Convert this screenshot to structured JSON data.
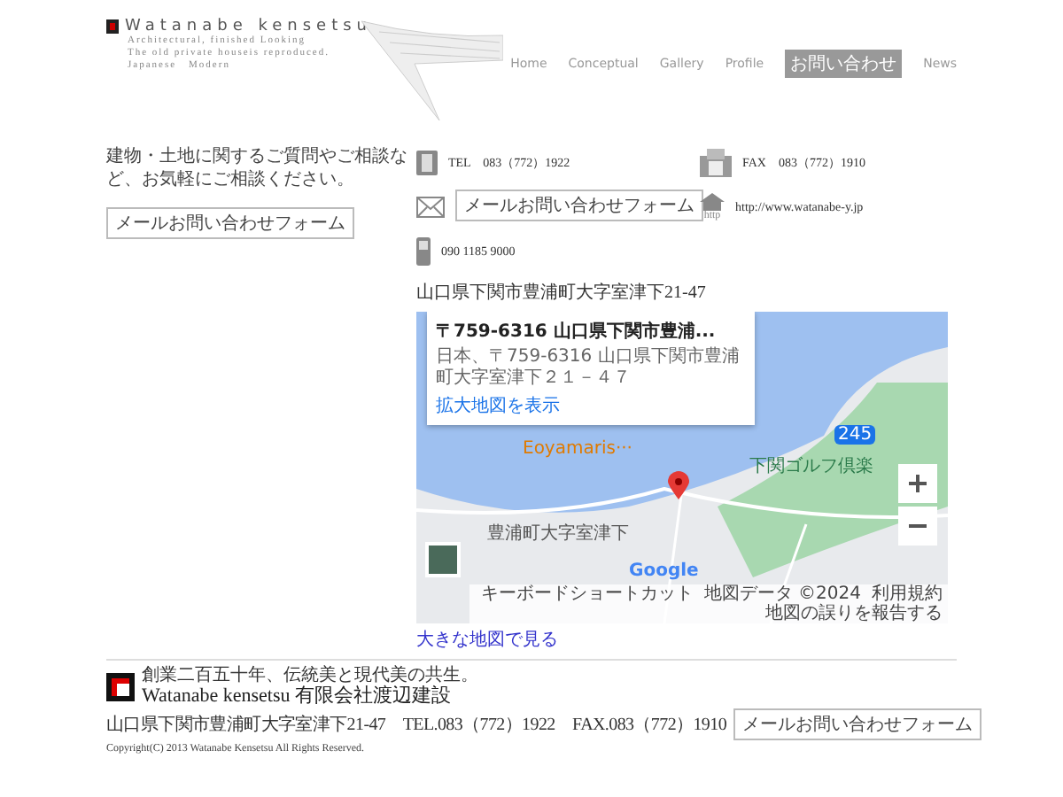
{
  "header": {
    "logo_text": "Watanabe kensetsu",
    "tagline": [
      "Architectural, finished Looking",
      "The old private houseis reproduced.",
      "Japanese　Modern"
    ]
  },
  "nav": [
    {
      "label": "Home",
      "selected": false
    },
    {
      "label": "Conceptual",
      "selected": false
    },
    {
      "label": "Gallery",
      "selected": false
    },
    {
      "label": "Profile",
      "selected": false
    },
    {
      "label": "お問い合わせ",
      "selected": true
    },
    {
      "label": "News",
      "selected": false
    }
  ],
  "intro": {
    "text": "建物・土地に関するご質問やご相談など、お気軽にご相談ください。",
    "button": "メールお問い合わせフォーム"
  },
  "contacts": {
    "tel": "TEL　083（772）1922",
    "mail_button": "メールお問い合わせフォーム",
    "mobile": "090 1185 9000",
    "fax": "FAX　083（772）1910",
    "http_label": "http",
    "url": "http://www.watanabe-y.jp"
  },
  "address": "山口県下関市豊浦町大字室津下21-47",
  "map": {
    "card_title": "〒759-6316 山口県下関市豊浦...",
    "card_address": "日本、〒759-6316 山口県下関市豊浦町大字室津下２１－４７",
    "card_link": "拡大地図を表示",
    "place_label": "Eoyamaris···",
    "golf_label": "下関ゴルフ倶楽",
    "town_label": "豊浦町大字室津下",
    "road_number": "245",
    "logo": "Google",
    "attribution": [
      "キーボードショートカット",
      "地図データ ©2024",
      "利用規約",
      "地図の誤りを報告する"
    ]
  },
  "map_link": "大きな地図で見る",
  "footer": {
    "tagline": "創業二百五十年、伝統美と現代美の共生。",
    "company": "Watanabe kensetsu 有限会社渡辺建設",
    "address_line": "山口県下関市豊浦町大字室津下21-47　TEL.083（772）1922　FAX.083（772）1910",
    "button": "メールお問い合わせフォーム",
    "copyright": "Copyright(C) 2013 Watanabe Kensetsu All Rights Reserved."
  }
}
